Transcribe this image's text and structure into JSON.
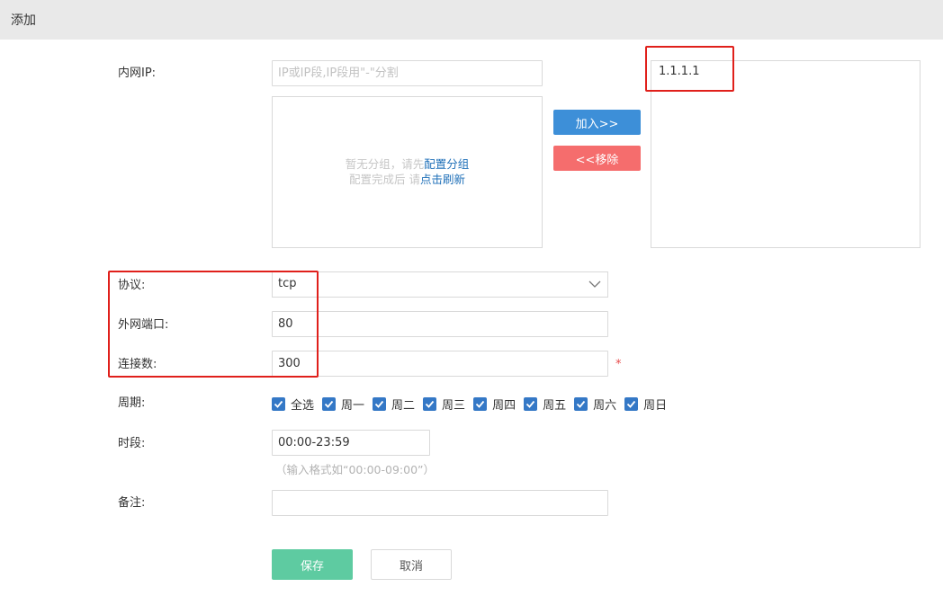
{
  "header": {
    "title": "添加"
  },
  "form": {
    "intranet_ip": {
      "label": "内网IP:",
      "placeholder": "IP或IP段,IP段用\"-\"分割",
      "empty_prefix": "暂无分组，请先",
      "empty_link": "配置分组",
      "empty_line2_prefix": "配置完成后 请",
      "empty_line2_link": "点击刷新",
      "add_button": "加入>>",
      "remove_button": "<<移除",
      "selected": [
        "1.1.1.1"
      ]
    },
    "protocol": {
      "label": "协议:",
      "value": "tcp"
    },
    "external_port": {
      "label": "外网端口:",
      "value": "80"
    },
    "connections": {
      "label": "连接数:",
      "value": "300",
      "required_mark": "*"
    },
    "period": {
      "label": "周期:",
      "days": [
        {
          "label": "全选",
          "checked": true
        },
        {
          "label": "周一",
          "checked": true
        },
        {
          "label": "周二",
          "checked": true
        },
        {
          "label": "周三",
          "checked": true
        },
        {
          "label": "周四",
          "checked": true
        },
        {
          "label": "周五",
          "checked": true
        },
        {
          "label": "周六",
          "checked": true
        },
        {
          "label": "周日",
          "checked": true
        }
      ]
    },
    "time_range": {
      "label": "时段:",
      "value": "00:00-23:59",
      "hint": "（输入格式如“00:00-09:00”）"
    },
    "remark": {
      "label": "备注:",
      "value": ""
    }
  },
  "actions": {
    "save": "保存",
    "cancel": "取消"
  },
  "colors": {
    "primary": "#3d8fd8",
    "danger": "#f56d6d",
    "save": "#5ecba1",
    "checkbox": "#3478c6",
    "highlight": "#e0201b"
  }
}
